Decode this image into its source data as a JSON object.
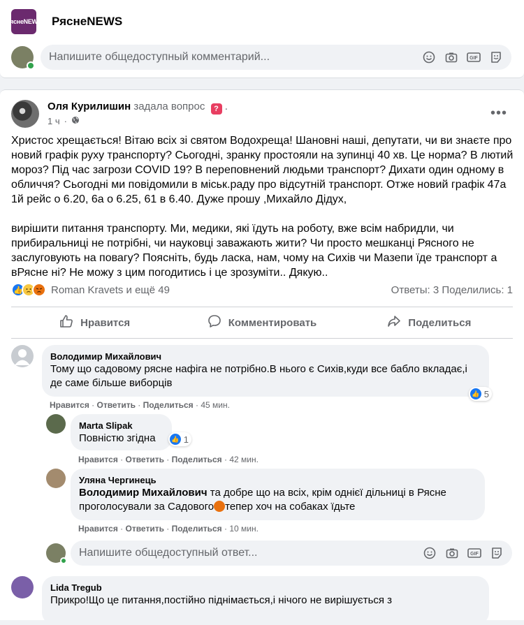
{
  "group": {
    "name": "РяснеNEWS",
    "logo_text": "РяснеNEWS"
  },
  "top_comment_box": {
    "placeholder": "Напишите общедоступный комментарий..."
  },
  "post": {
    "author": "Оля Курилишин",
    "action": "задала вопрос",
    "time": "1 ч",
    "paragraph1": "Христос хрещається! Вітаю всіх зі святом Водохреща! Шановні наші, депутати, чи ви знаєте про новий  графік руху транспорту? Сьогодні, зранку простояли на зупинці 40 хв. Це норма? В лютий мороз? Під час загрози COVID 19? В переповнений людьми транспорт? Дихати один одному в обличчя? Сьогодні ми повідомили в міськ.раду про  відсутній транспорт. Отже новий графік 47а 1й рейс о 6.20, 6а о 6.25, 61 в 6.40. Дуже прошу ,Михайло Дідух,",
    "paragraph2": "вирішити питання транспорту. Ми, медики, які їдуть на роботу, вже всім набридли, чи прибиральниці не потрібні, чи науковці заважають  жити? Чи просто мешканці Рясного не заслуговують на повагу? Поясніть, будь ласка, нам, чому на Сихів чи Мазепи їде транспорт а вРясне ні? Не можу  з цим погодитись і це зрозуміти.. Дякую..",
    "reactors": "Roman Kravets и ещё 49",
    "counts": "Ответы: 3  Поделились: 1"
  },
  "actions": {
    "like": "Нравится",
    "comment": "Комментировать",
    "share": "Поделиться"
  },
  "comments": [
    {
      "name": "Володимир Михайлович",
      "text": "Тому що садовому рясне нафіга не потрібно.В нього є Сихів,куди все бабло вкладає,і де саме більше виборців",
      "like": "Нравится",
      "reply": "Ответить",
      "share": "Поделиться",
      "time": "45 мин.",
      "reactions": "5"
    },
    {
      "name": "Marta Slipak",
      "text": "Повністю згідна",
      "like": "Нравится",
      "reply": "Ответить",
      "share": "Поделиться",
      "time": "42 мин.",
      "reactions": "1"
    },
    {
      "name": "Уляна Чергинець",
      "mention": "Володимир Михайлович",
      "text_a": " та добре що на всіх, крім однієї дільниці в Рясне проголосували за Садового",
      "text_b": "тепер хоч на собаках їдьте",
      "like": "Нравится",
      "reply": "Ответить",
      "share": "Поделиться",
      "time": "10 мин."
    },
    {
      "name": "Lida Tregub",
      "text": "Прикро!Що це питання,постійно піднімається,і нічого не вирішується з"
    }
  ],
  "reply_box": {
    "placeholder": "Напишите общедоступный ответ..."
  },
  "colors": {
    "accent": "#1877f2",
    "online": "#31a24c",
    "logo": "#6b2a6e"
  }
}
